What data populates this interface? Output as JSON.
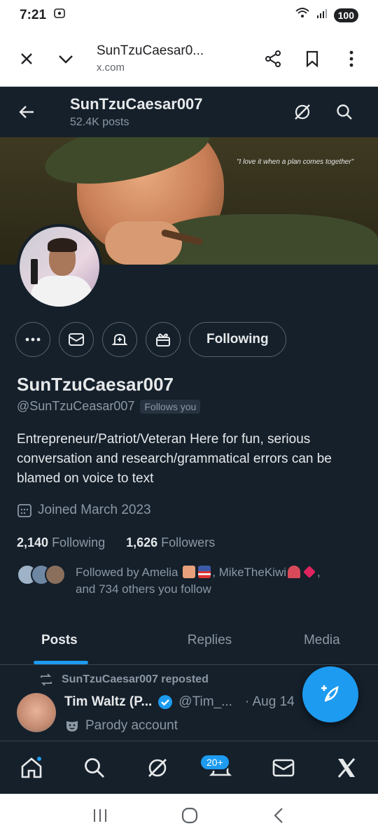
{
  "status_bar": {
    "time": "7:21",
    "battery": "100"
  },
  "browser": {
    "title": "SunTzuCaesar0...",
    "url": "x.com"
  },
  "header": {
    "name": "SunTzuCaesar007",
    "post_count": "52.4K posts"
  },
  "banner": {
    "quote": "\"I love it when a plan comes together\""
  },
  "profile": {
    "following_button": "Following",
    "display_name": "SunTzuCaesar007",
    "handle": "@SunTzuCeasar007",
    "follows_you": "Follows you",
    "bio": "Entrepreneur/Patriot/Veteran Here for fun, serious conversation and research/grammatical errors can be blamed on voice to text",
    "joined": "Joined March 2023",
    "following_count": "2,140",
    "following_label": "Following",
    "followers_count": "1,626",
    "followers_label": "Followers",
    "followed_by_prefix": "Followed by Amelia",
    "followed_by_mid": ", MikeTheKiwi",
    "followed_by_suffix": ",",
    "followed_by_line2": "and 734 others you follow"
  },
  "tabs": [
    {
      "label": "Posts"
    },
    {
      "label": "Replies"
    },
    {
      "label": "Media"
    }
  ],
  "post": {
    "repost_text": "SunTzuCaesar007 reposted",
    "author_name": "Tim Waltz (P...",
    "author_handle": "@Tim_...",
    "date": "· Aug 14",
    "label": "Parody account"
  },
  "bottom_nav": {
    "notifications_badge": "20+"
  },
  "colors": {
    "background": "#15202b",
    "accent": "#1d9bf0",
    "muted": "#8b98a5",
    "border": "#536471"
  }
}
